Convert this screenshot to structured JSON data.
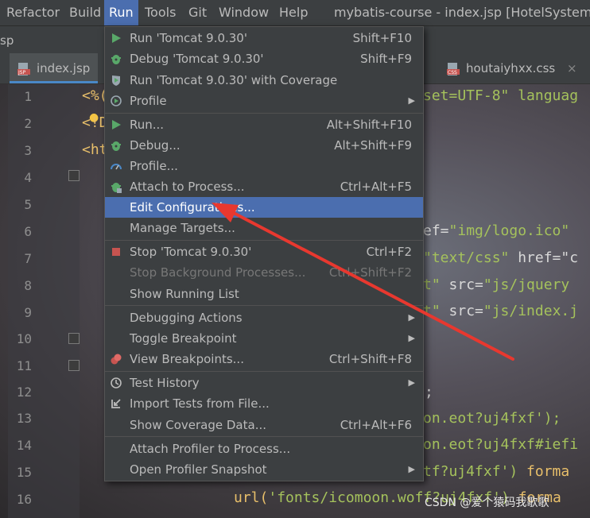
{
  "menubar": {
    "items": [
      "Refactor",
      "Build",
      "Run",
      "Tools",
      "Git",
      "Window",
      "Help"
    ],
    "active_item": "Run",
    "window_title": "mybatis-course - index.jsp [HotelSystem] - A"
  },
  "project_label": "sp",
  "tabs": [
    {
      "label": "index.jsp",
      "icon": "jsp-file-icon",
      "active": true
    },
    {
      "label": "houtaiyhxx.css",
      "icon": "css-file-icon",
      "active": false
    }
  ],
  "editor": {
    "line_numbers": [
      "1",
      "2",
      "3",
      "4",
      "5",
      "6",
      "7",
      "8",
      "9",
      "10",
      "11",
      "12",
      "13",
      "14",
      "15",
      "16"
    ],
    "code_fragments": {
      "l1_start": "<%(",
      "l1_end": "set=UTF-8\" languag",
      "l2_start": "<!D",
      "l3_start": "<ht",
      "l6_attr": "ef=",
      "l6_val": "\"img/logo.ico\"",
      "l7_val": "\"text/css\"",
      "l7_attr": " href=\"c",
      "l8_a": "t\"",
      "l8_b": " src=",
      "l8_c": "\"js/jquery",
      "l9_a": "t\"",
      "l9_b": " src=",
      "l9_c": "\"js/index.j",
      "l12": ";",
      "l13": "on.eot?uj4fxf');",
      "l14": "on.eot?uj4fxf#iefi",
      "l15_a": "tf?uj4fxf') ",
      "l15_b": "forma",
      "l16_a": "url(",
      "l16_b": "'fonts/icomoon.woff?uj4fxf') ",
      "l16_c": "forma"
    }
  },
  "run_menu": {
    "items": [
      {
        "label": "Run 'Tomcat 9.0.30'",
        "shortcut": "Shift+F10",
        "icon": "run-icon"
      },
      {
        "label": "Debug 'Tomcat 9.0.30'",
        "shortcut": "Shift+F9",
        "icon": "debug-icon"
      },
      {
        "label": "Run 'Tomcat 9.0.30' with Coverage",
        "shortcut": "",
        "icon": "coverage-icon"
      },
      {
        "label": "Profile",
        "shortcut": "",
        "icon": "profile-icon",
        "submenu": true
      },
      {
        "label": "Run...",
        "shortcut": "Alt+Shift+F10",
        "icon": "run-icon"
      },
      {
        "label": "Debug...",
        "shortcut": "Alt+Shift+F9",
        "icon": "debug-icon"
      },
      {
        "label": "Profile...",
        "shortcut": "",
        "icon": "profiler-gauge-icon"
      },
      {
        "label": "Attach to Process...",
        "shortcut": "Ctrl+Alt+F5",
        "icon": "attach-debug-icon"
      },
      {
        "label": "Edit Configurations...",
        "shortcut": "",
        "selected": true
      },
      {
        "label": "Manage Targets...",
        "shortcut": ""
      },
      {
        "label": "Stop 'Tomcat 9.0.30'",
        "shortcut": "Ctrl+F2",
        "icon": "stop-icon"
      },
      {
        "label": "Stop Background Processes...",
        "shortcut": "Ctrl+Shift+F2",
        "disabled": true
      },
      {
        "label": "Show Running List",
        "shortcut": ""
      },
      {
        "label": "Debugging Actions",
        "shortcut": "",
        "submenu": true
      },
      {
        "label": "Toggle Breakpoint",
        "shortcut": "",
        "submenu": true
      },
      {
        "label": "View Breakpoints...",
        "shortcut": "Ctrl+Shift+F8",
        "icon": "breakpoints-icon"
      },
      {
        "label": "Test History",
        "shortcut": "",
        "icon": "history-icon",
        "submenu": true
      },
      {
        "label": "Import Tests from File...",
        "shortcut": "",
        "icon": "import-icon"
      },
      {
        "label": "Show Coverage Data...",
        "shortcut": "Ctrl+Alt+F6"
      },
      {
        "label": "Attach Profiler to Process...",
        "shortcut": ""
      },
      {
        "label": "Open Profiler Snapshot",
        "shortcut": "",
        "submenu": true
      }
    ]
  },
  "watermark": "CSDN @爱个猿码我歌歌",
  "colors": {
    "menu_bg": "#3c3f41",
    "selection": "#4b6eaf",
    "annotation_arrow": "#e8382f",
    "string": "#a5c25c",
    "keyword": "#e8bf6a"
  }
}
